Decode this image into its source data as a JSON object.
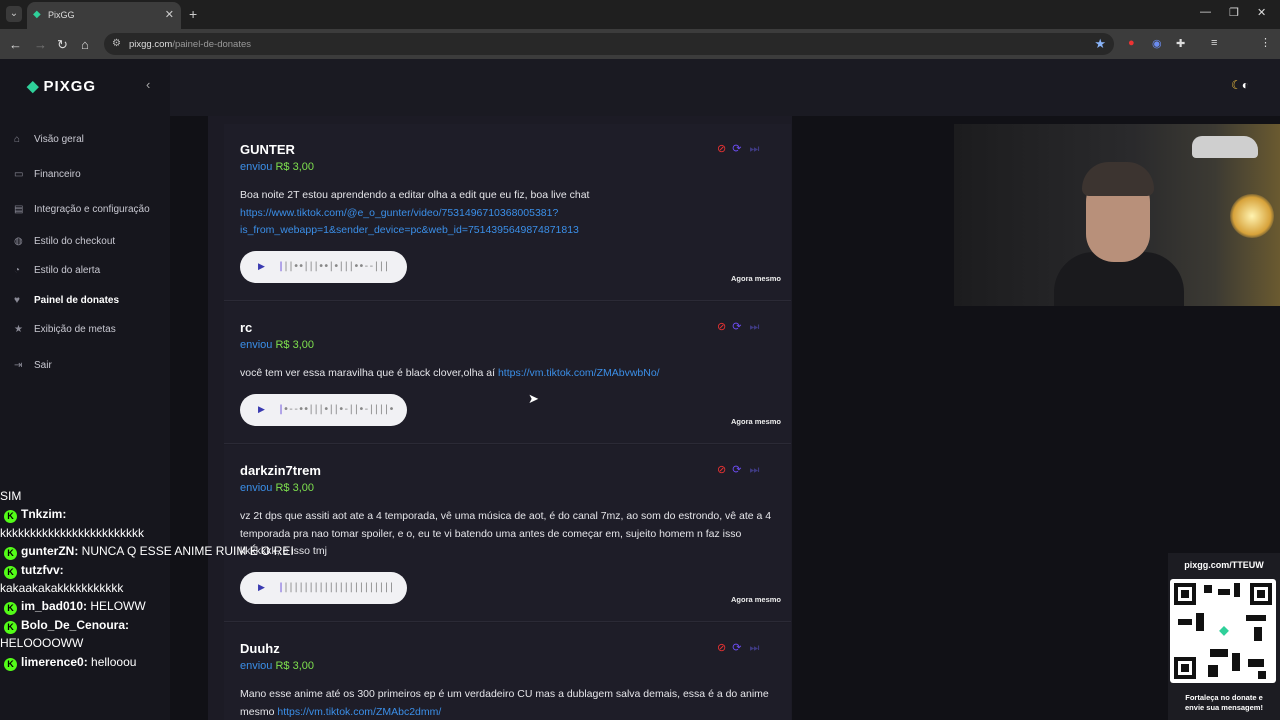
{
  "browser": {
    "tab_title": "PixGG",
    "url_host": "pixgg.com",
    "url_path": "/painel-de-donates"
  },
  "sidebar": {
    "logo": "PIXGG",
    "items": [
      {
        "label": "Visão geral",
        "icon": "home-icon"
      },
      {
        "label": "Financeiro",
        "icon": "wallet-icon"
      },
      {
        "label": "Integração e configuração",
        "icon": "config-icon"
      },
      {
        "label": "Estilo do checkout",
        "icon": "palette-icon"
      },
      {
        "label": "Estilo do alerta",
        "icon": "alert-icon"
      },
      {
        "label": "Painel de donates",
        "icon": "donate-icon",
        "active": true
      },
      {
        "label": "Exibição de metas",
        "icon": "star-icon"
      },
      {
        "label": "Sair",
        "icon": "logout-icon"
      }
    ]
  },
  "donates": [
    {
      "name": "GUNTER",
      "sent_label": "enviou",
      "amount": "R$ 3,00",
      "message": "Boa noite 2T estou aprendendo a editar olha a edit que eu fiz, boa live chat",
      "link": "https://www.tiktok.com/@e_o_gunter/video/7531496710368005381?is_from_webapp=1&sender_device=pc&web_id=7514395649874871813",
      "link_line1": "https://www.tiktok.com/@e_o_gunter/video/7531496710368005381?",
      "link_line2": "is_from_webapp=1&sender_device=pc&web_id=7514395649874871813",
      "time": "Agora mesmo"
    },
    {
      "name": "rc",
      "sent_label": "enviou",
      "amount": "R$ 3,00",
      "message": "você tem ver essa maravilha que é black clover,olha aí",
      "link": "https://vm.tiktok.com/ZMAbvwbNo/",
      "time": "Agora mesmo"
    },
    {
      "name": "darkzin7trem",
      "sent_label": "enviou",
      "amount": "R$ 3,00",
      "message": "vz 2t dps que assiti aot ate a 4 temporada, vê uma música de aot, é do canal 7mz, ao som do estrondo, vê ate a 4 temporada pra nao tomar spoiler, e o, eu te vi batendo uma antes de começar em, sujeito homem n faz isso kkkkkkk, é isso tmj",
      "time": "Agora mesmo"
    },
    {
      "name": "Duuhz",
      "sent_label": "enviou",
      "amount": "R$ 3,00",
      "message": "Mano esse anime até os 300 primeiros ep é um verdadeiro CU mas a dublagem salva demais, essa é a do anime mesmo",
      "link": "https://vm.tiktok.com/ZMAbc2dmm/"
    }
  ],
  "chat": [
    {
      "user": "",
      "text": "SIM"
    },
    {
      "user": "Tnkzim:",
      "text": "kkkkkkkkkkkkkkkkkkkkkkkk"
    },
    {
      "user": "gunterZN:",
      "text": "NUNCA Q ESSE ANIME RUIM É O REI"
    },
    {
      "user": "tutzfvv:",
      "text": "kakaakakakkkkkkkkkkk"
    },
    {
      "user": "im_bad010:",
      "text": "HELOWW"
    },
    {
      "user": "Bolo_De_Cenoura:",
      "text": "HELOOOOWW"
    },
    {
      "user": "limerence0:",
      "text": "hellooou"
    }
  ],
  "qr": {
    "url": "pixgg.com/TTEUW",
    "caption_line1": "Fortaleça no donate e",
    "caption_line2": "envie sua mensagem!"
  },
  "colors": {
    "accent": "#3b8fe8",
    "amount": "#7ee04e",
    "brand": "#2fd09a",
    "kick": "#53fc18"
  }
}
